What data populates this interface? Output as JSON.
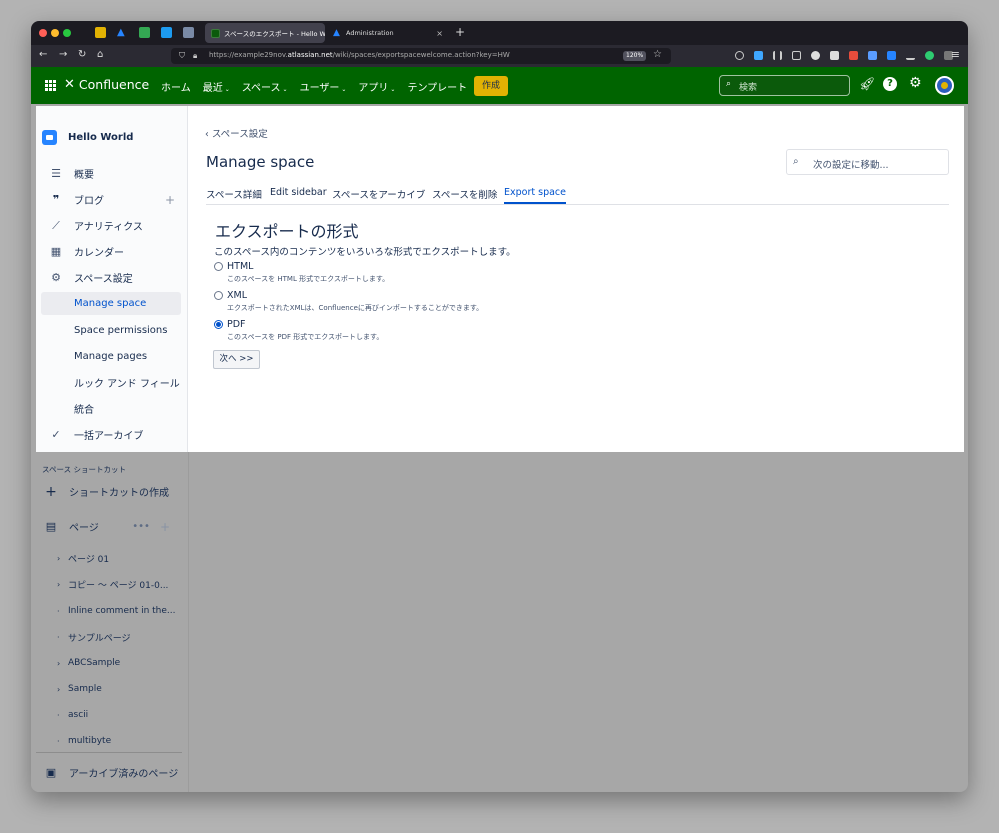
{
  "browser": {
    "tabs": [
      {
        "title": "スペースのエクスポート - Hello W",
        "active": true
      },
      {
        "title": "Administration",
        "active": false
      }
    ],
    "url_prefix": "https://example29nov.",
    "url_domain": "atlassian.net",
    "url_path": "/wiki/spaces/exportspacewelcome.action?key=HW",
    "zoom": "120%"
  },
  "header": {
    "product": "Confluence",
    "nav": [
      "ホーム",
      "最近",
      "スペース",
      "ユーザー",
      "アプリ",
      "テンプレート"
    ],
    "create_label": "作成",
    "search_placeholder": "検索"
  },
  "sidebar": {
    "space_name": "Hello World",
    "items": [
      {
        "label": "概要",
        "icon": "overview-icon"
      },
      {
        "label": "ブログ",
        "icon": "blog-quote-icon"
      },
      {
        "label": "アナリティクス",
        "icon": "analytics-icon"
      },
      {
        "label": "カレンダー",
        "icon": "calendar-icon"
      },
      {
        "label": "スペース設定",
        "icon": "gear-icon"
      }
    ],
    "settings_sub": [
      "Manage space",
      "Space permissions",
      "Manage pages",
      "ルック アンド フィール",
      "統合"
    ],
    "bulk_archive": "一括アーカイブ",
    "shortcuts_heading": "スペース ショートカット",
    "create_shortcut": "ショートカットの作成",
    "pages_label": "ページ",
    "tree": [
      {
        "label": "ページ 01",
        "expandable": true
      },
      {
        "label": "コピー ～ ページ 01-0...",
        "expandable": true
      },
      {
        "label": "Inline comment in the...",
        "expandable": false
      },
      {
        "label": "サンプルページ",
        "expandable": false
      },
      {
        "label": "ABCSample",
        "expandable": true
      },
      {
        "label": "Sample",
        "expandable": true
      },
      {
        "label": "ascii",
        "expandable": false
      },
      {
        "label": "multibyte",
        "expandable": false
      }
    ],
    "archived_pages": "アーカイブ済みのページ"
  },
  "main": {
    "back_link": "スペース設定",
    "title": "Manage space",
    "settings_search_placeholder": "次の設定に移動...",
    "tabs": [
      "スペース詳細",
      "Edit sidebar",
      "スペースをアーカイブ",
      "スペースを削除",
      "Export space"
    ],
    "active_tab": "Export space",
    "section_title": "エクスポートの形式",
    "section_desc": "このスペース内のコンテンツをいろいろな形式でエクスポートします。",
    "options": [
      {
        "label": "HTML",
        "desc": "このスペースを HTML 形式でエクスポートします。",
        "selected": false
      },
      {
        "label": "XML",
        "desc": "エクスポートされたXMLは、Confluenceに再びインポートすることができます。",
        "selected": false
      },
      {
        "label": "PDF",
        "desc": "このスペースを PDF 形式でエクスポートします。",
        "selected": true
      }
    ],
    "next_button": "次へ >>"
  },
  "colors": {
    "header_bg": "#006400",
    "create_button": "#e2b203",
    "link_blue": "#0052cc"
  }
}
